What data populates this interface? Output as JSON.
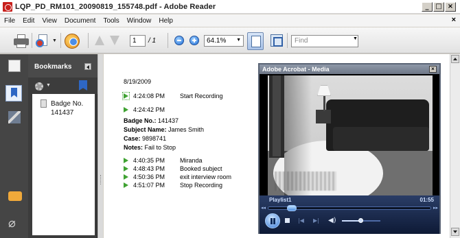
{
  "window": {
    "title": "LQP_PD_RM101_20090819_155748.pdf - Adobe Reader",
    "buttons": {
      "minimize": "_",
      "maximize": "□",
      "close": "×"
    }
  },
  "menu": {
    "items": [
      "File",
      "Edit",
      "View",
      "Document",
      "Tools",
      "Window",
      "Help"
    ],
    "close": "×"
  },
  "toolbar": {
    "page_current": "1",
    "page_total": "/ 1",
    "zoom": "64.1%",
    "find_placeholder": "Find"
  },
  "bookmarks": {
    "title": "Bookmarks",
    "items": [
      {
        "label": "Badge No. 141437"
      }
    ]
  },
  "document": {
    "date": "8/19/2009",
    "first_events": [
      {
        "time": "4:24:08 PM",
        "label": "Start Recording"
      },
      {
        "time": "4:24:42 PM",
        "label": ""
      }
    ],
    "details": {
      "badge_label": "Badge No.:",
      "badge_value": "141437",
      "subject_label": "Subject Name:",
      "subject_value": "James Smith",
      "case_label": "Case:",
      "case_value": "9898741",
      "notes_label": "Notes:",
      "notes_value": "Fail to Stop"
    },
    "events": [
      {
        "time": "4:40:35 PM",
        "label": "Miranda"
      },
      {
        "time": "4:48:43 PM",
        "label": "Booked subject"
      },
      {
        "time": "4:50:36 PM",
        "label": "exit interview room"
      },
      {
        "time": "4:51:07 PM",
        "label": "Stop Recording"
      }
    ],
    "play_icon_color": "#3fa232"
  },
  "media": {
    "title": "Adobe Acrobat - Media",
    "playlist": "Playlist1",
    "time": "01:55",
    "seek_fraction": 0.12,
    "volume_fraction": 0.5,
    "accent": "#3577d6"
  }
}
